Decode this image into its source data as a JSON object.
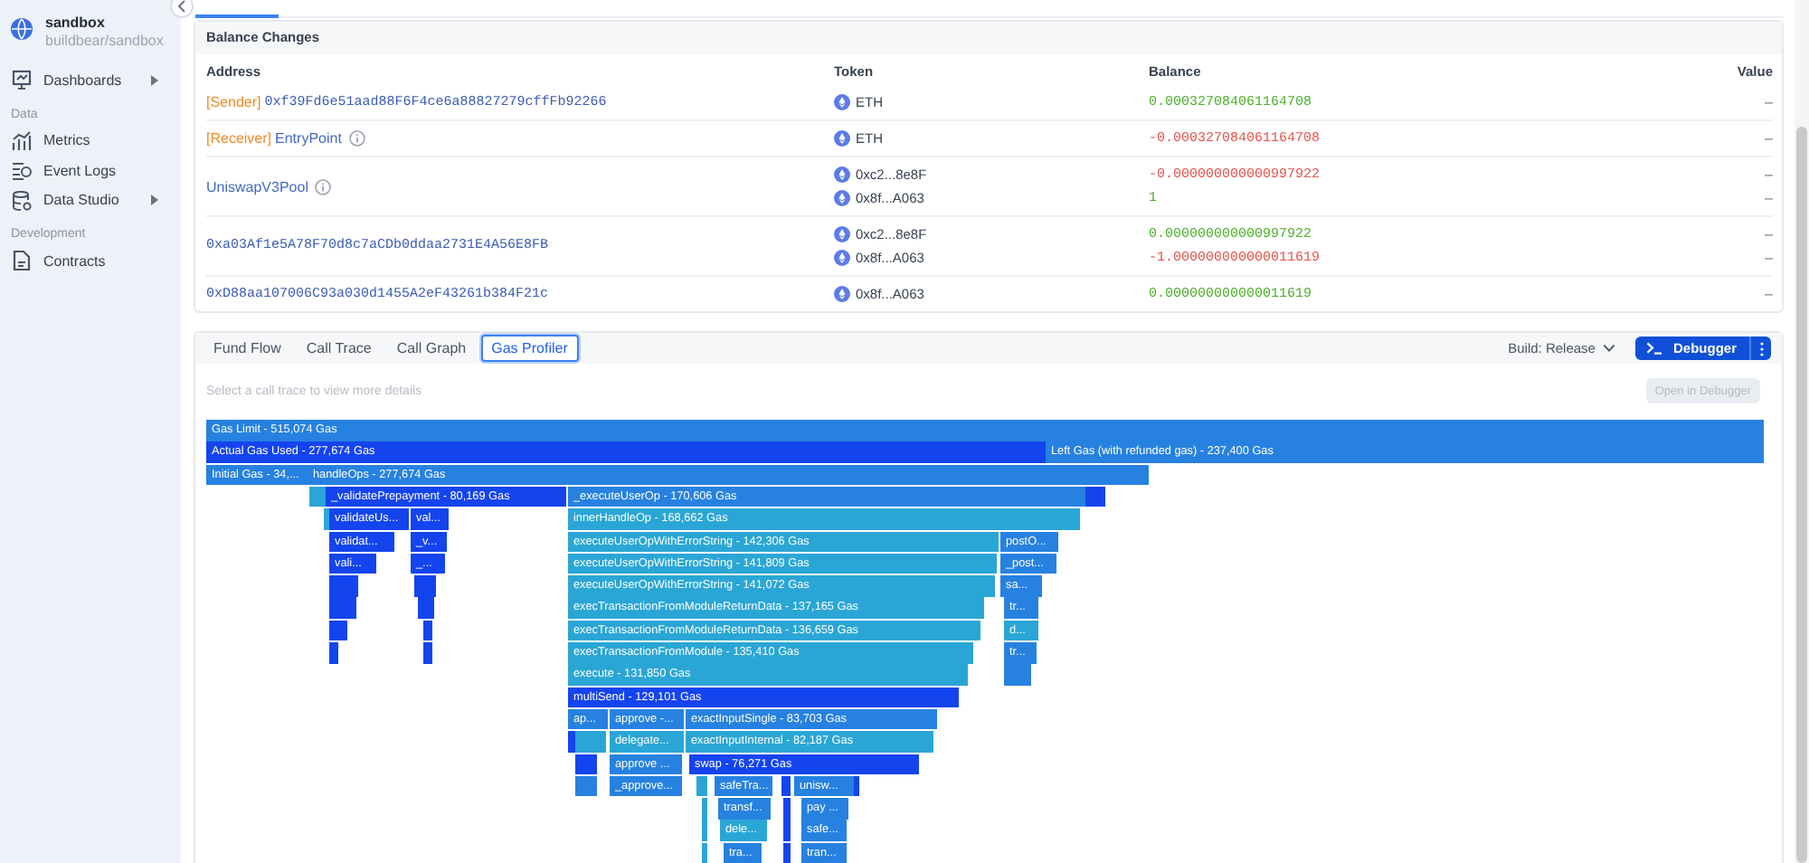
{
  "sidebar": {
    "project": {
      "name": "sandbox",
      "path": "buildbear/sandbox"
    },
    "sections": [
      {
        "items": [
          {
            "label": "Dashboards",
            "expandable": true
          }
        ]
      },
      {
        "title": "Data",
        "items": [
          {
            "label": "Metrics",
            "expandable": false
          },
          {
            "label": "Event Logs",
            "expandable": false
          },
          {
            "label": "Data Studio",
            "expandable": true
          }
        ]
      },
      {
        "title": "Development",
        "items": [
          {
            "label": "Contracts",
            "expandable": false
          }
        ]
      }
    ]
  },
  "balance_changes": {
    "title": "Balance Changes",
    "columns": [
      "Address",
      "Token",
      "Balance",
      "Value"
    ],
    "rows": [
      {
        "address": {
          "role": "[Sender]",
          "text": "0xf39Fd6e51aad88F6F4ce6a88827279cffFb92266",
          "kind": "hex",
          "info": false
        },
        "tokens": [
          {
            "symbol": "ETH",
            "balance": "0.000327084061164708",
            "color": "#4caf2a",
            "value": "–"
          }
        ]
      },
      {
        "address": {
          "role": "[Receiver]",
          "text": "EntryPoint",
          "kind": "name",
          "info": true
        },
        "tokens": [
          {
            "symbol": "ETH",
            "balance": "-0.000327084061164708",
            "color": "#e5534b",
            "value": "–"
          }
        ]
      },
      {
        "address": {
          "text": "UniswapV3Pool",
          "kind": "name",
          "info": true
        },
        "tokens": [
          {
            "symbol": "0xc2...8e8F",
            "balance": "-0.000000000000997922",
            "color": "#e5534b",
            "value": "–"
          },
          {
            "symbol": "0x8f...A063",
            "balance": "1",
            "color": "#4caf2a",
            "value": "–"
          }
        ]
      },
      {
        "address": {
          "text": "0xa03Af1e5A78F70d8c7aCDb0ddaa2731E4A56E8FB",
          "kind": "hex",
          "info": false
        },
        "tokens": [
          {
            "symbol": "0xc2...8e8F",
            "balance": "0.000000000000997922",
            "color": "#4caf2a",
            "value": "–"
          },
          {
            "symbol": "0x8f...A063",
            "balance": "-1.000000000000011619",
            "color": "#e5534b",
            "value": "–"
          }
        ]
      },
      {
        "address": {
          "text": "0xD88aa107006C93a030d1455A2eF43261b384F21c",
          "kind": "hex",
          "info": false
        },
        "tokens": [
          {
            "symbol": "0x8f...A063",
            "balance": "0.000000000000011619",
            "color": "#4caf2a",
            "value": "–"
          }
        ]
      }
    ]
  },
  "analysis": {
    "tabs": [
      {
        "label": "Fund Flow",
        "selected": false
      },
      {
        "label": "Call Trace",
        "selected": false
      },
      {
        "label": "Call Graph",
        "selected": false
      },
      {
        "label": "Gas Profiler",
        "selected": true
      }
    ],
    "build": "Build: Release",
    "debugger_button": "Debugger",
    "hint": "Select a call trace to view more details",
    "open_button": {
      "label": "Open in Debugger",
      "disabled": true
    },
    "flame_rows": [
      [
        {
          "label": "Gas Limit - 515,074 Gas",
          "color": "#2681e0"
        }
      ],
      [
        {
          "label": "Actual Gas Used - 277,674 Gas",
          "color": "#1444ee"
        },
        {
          "label": "Left Gas (with refunded gas) - 237,400 Gas",
          "color": "#2681e0"
        }
      ],
      [
        {
          "label": "Initial Gas - 34,...",
          "color": "#2681e0"
        },
        {
          "label": "handleOps - 277,674 Gas",
          "color": "#2681e0"
        }
      ],
      [
        {
          "color": "#2aa6d6"
        },
        {
          "label": "_validatePrepayment - 80,169 Gas",
          "color": "#1444ee"
        },
        {
          "label": "_executeUserOp - 170,606 Gas",
          "color": "#2681e0"
        },
        {
          "color": "#1444ee"
        }
      ],
      [
        {
          "color": "#2aa6d6"
        },
        {
          "label": "validateUs...",
          "color": "#1444ee"
        },
        {
          "label": "val...",
          "color": "#1444ee"
        },
        {
          "label": "innerHandleOp - 168,662 Gas",
          "color": "#2aa6d6"
        }
      ],
      [
        {
          "label": "validat...",
          "color": "#1444ee"
        },
        {
          "label": "_v...",
          "color": "#1444ee"
        },
        {
          "label": "executeUserOpWithErrorString - 142,306 Gas",
          "color": "#2aa6d6"
        },
        {
          "label": "postO...",
          "color": "#2681e0"
        }
      ],
      [
        {
          "label": "vali...",
          "color": "#1444ee"
        },
        {
          "label": "_...",
          "color": "#1444ee"
        },
        {
          "label": "executeUserOpWithErrorString - 141,809 Gas",
          "color": "#2aa6d6"
        },
        {
          "label": "_post...",
          "color": "#2681e0"
        }
      ],
      [
        {
          "color": "#1444ee"
        },
        {
          "color": "#1444ee"
        },
        {
          "label": "executeUserOpWithErrorString - 141,072 Gas",
          "color": "#2aa6d6"
        },
        {
          "label": "sa...",
          "color": "#2681e0"
        }
      ],
      [
        {
          "color": "#1444ee"
        },
        {
          "color": "#1444ee"
        },
        {
          "label": "execTransactionFromModuleReturnData - 137,165 Gas",
          "color": "#2aa6d6"
        },
        {
          "label": "tr...",
          "color": "#2681e0"
        }
      ],
      [
        {
          "color": "#1444ee"
        },
        {
          "color": "#1444ee"
        },
        {
          "label": "execTransactionFromModuleReturnData - 136,659 Gas",
          "color": "#2aa6d6"
        },
        {
          "label": "d...",
          "color": "#2aa6d6"
        }
      ],
      [
        {
          "color": "#1444ee"
        },
        {
          "color": "#1444ee"
        },
        {
          "label": "execTransactionFromModule - 135,410 Gas",
          "color": "#2aa6d6"
        },
        {
          "label": "tr...",
          "color": "#2681e0"
        }
      ],
      [
        {
          "label": "execute - 131,850 Gas",
          "color": "#2aa6d6"
        },
        {
          "color": "#2681e0"
        }
      ],
      [
        {
          "label": "multiSend - 129,101 Gas",
          "color": "#1444ee"
        }
      ],
      [
        {
          "label": "ap...",
          "color": "#2681e0"
        },
        {
          "label": "approve -...",
          "color": "#2681e0"
        },
        {
          "label": "exactInputSingle - 83,703 Gas",
          "color": "#2681e0"
        }
      ],
      [
        {
          "color": "#1444ee"
        },
        {
          "color": "#2aa6d6"
        },
        {
          "label": "delegate...",
          "color": "#2aa6d6"
        },
        {
          "label": "exactInputInternal - 82,187 Gas",
          "color": "#2aa6d6"
        }
      ],
      [
        {
          "color": "#1444ee"
        },
        {
          "label": "approve ...",
          "color": "#2681e0"
        },
        {
          "label": "swap - 76,271 Gas",
          "color": "#1444ee"
        }
      ],
      [
        {
          "color": "#2681e0"
        },
        {
          "label": "_approve...",
          "color": "#2681e0"
        },
        {
          "color": "#2aa6d6"
        },
        {
          "label": "safeTra...",
          "color": "#2681e0"
        },
        {
          "color": "#1444ee"
        },
        {
          "label": "unisw...",
          "color": "#2681e0"
        },
        {
          "color": "#1444ee"
        }
      ],
      [
        {
          "color": "#2aa6d6"
        },
        {
          "label": "transf...",
          "color": "#2681e0"
        },
        {
          "color": "#1444ee"
        },
        {
          "label": "pay ...",
          "color": "#2681e0"
        }
      ],
      [
        {
          "color": "#2aa6d6"
        },
        {
          "label": "dele...",
          "color": "#2aa6d6"
        },
        {
          "color": "#1444ee"
        },
        {
          "label": "safe...",
          "color": "#2681e0"
        }
      ],
      [
        {
          "color": "#2aa6d6"
        },
        {
          "label": "tra...",
          "color": "#2681e0"
        },
        {
          "color": "#1444ee"
        },
        {
          "label": "tran...",
          "color": "#2681e0"
        }
      ]
    ]
  }
}
